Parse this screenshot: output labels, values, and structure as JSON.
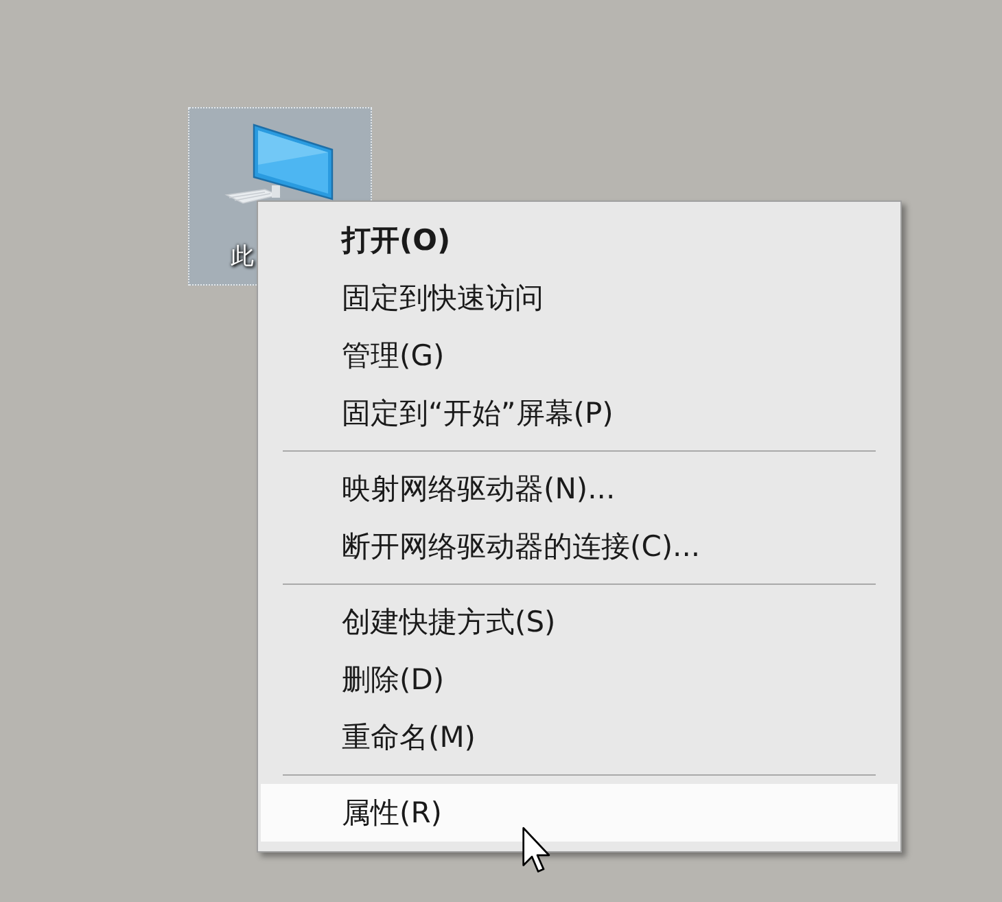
{
  "desktop_icon": {
    "label": "此",
    "selected": true
  },
  "context_menu": {
    "items": [
      {
        "kind": "item",
        "label": "打开(O)",
        "default": true,
        "selected": false
      },
      {
        "kind": "item",
        "label": "固定到快速访问",
        "default": false,
        "selected": false
      },
      {
        "kind": "item",
        "label": "管理(G)",
        "default": false,
        "selected": false
      },
      {
        "kind": "item",
        "label": "固定到“开始”屏幕(P)",
        "default": false,
        "selected": false
      },
      {
        "kind": "separator"
      },
      {
        "kind": "item",
        "label": "映射网络驱动器(N)...",
        "default": false,
        "selected": false
      },
      {
        "kind": "item",
        "label": "断开网络驱动器的连接(C)...",
        "default": false,
        "selected": false
      },
      {
        "kind": "separator"
      },
      {
        "kind": "item",
        "label": "创建快捷方式(S)",
        "default": false,
        "selected": false
      },
      {
        "kind": "item",
        "label": "删除(D)",
        "default": false,
        "selected": false
      },
      {
        "kind": "item",
        "label": "重命名(M)",
        "default": false,
        "selected": false
      },
      {
        "kind": "separator"
      },
      {
        "kind": "item",
        "label": "属性(R)",
        "default": false,
        "selected": true
      }
    ]
  }
}
